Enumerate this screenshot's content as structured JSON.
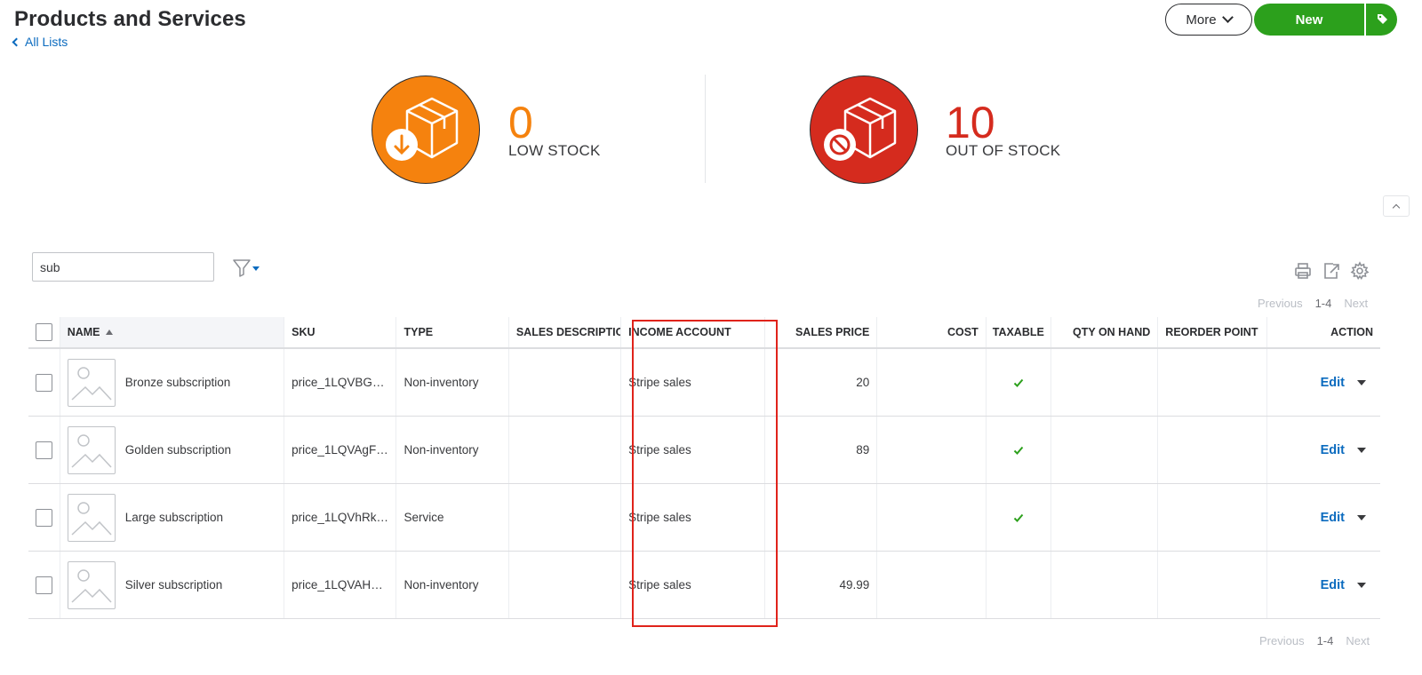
{
  "header": {
    "title": "Products and Services",
    "back_link": "All Lists",
    "more_label": "More",
    "new_label": "New"
  },
  "stats": {
    "low_stock": {
      "count": "0",
      "label": "LOW STOCK",
      "color": "#f5820e"
    },
    "out_of_stock": {
      "count": "10",
      "label": "OUT OF STOCK",
      "color": "#d52b1e"
    }
  },
  "search": {
    "value": "sub"
  },
  "pager": {
    "previous": "Previous",
    "range": "1-4",
    "next": "Next"
  },
  "table": {
    "columns": {
      "name": "NAME",
      "sku": "SKU",
      "type": "TYPE",
      "sales_description": "SALES DESCRIPTION",
      "income_account": "INCOME ACCOUNT",
      "sales_price": "SALES PRICE",
      "cost": "COST",
      "taxable": "TAXABLE",
      "qty_on_hand": "QTY ON HAND",
      "reorder_point": "REORDER POINT",
      "action": "ACTION"
    },
    "rows": [
      {
        "name": "Bronze subscription",
        "sku": "price_1LQVBGF…",
        "type": "Non-inventory",
        "sales_description": "",
        "income_account": "Stripe sales",
        "sales_price": "20",
        "cost": "",
        "taxable": true,
        "qty_on_hand": "",
        "reorder_point": "",
        "action": "Edit"
      },
      {
        "name": "Golden subscription",
        "sku": "price_1LQVAgF…",
        "type": "Non-inventory",
        "sales_description": "",
        "income_account": "Stripe sales",
        "sales_price": "89",
        "cost": "",
        "taxable": true,
        "qty_on_hand": "",
        "reorder_point": "",
        "action": "Edit"
      },
      {
        "name": "Large subscription",
        "sku": "price_1LQVhRk…",
        "type": "Service",
        "sales_description": "",
        "income_account": "Stripe sales",
        "sales_price": "",
        "cost": "",
        "taxable": true,
        "qty_on_hand": "",
        "reorder_point": "",
        "action": "Edit"
      },
      {
        "name": "Silver subscription",
        "sku": "price_1LQVAHF…",
        "type": "Non-inventory",
        "sales_description": "",
        "income_account": "Stripe sales",
        "sales_price": "49.99",
        "cost": "",
        "taxable": false,
        "qty_on_hand": "",
        "reorder_point": "",
        "action": "Edit"
      }
    ]
  },
  "colors": {
    "accent_green": "#2ca01c",
    "link_blue": "#0b6bbf",
    "highlight_red": "#e0231b",
    "check_green": "#2ca01c"
  },
  "icons": [
    "chevron-left-icon",
    "chevron-down-icon",
    "box-download-icon",
    "box-blocked-icon",
    "filter-icon",
    "print-icon",
    "export-icon",
    "gear-icon",
    "image-placeholder-icon",
    "check-icon",
    "caret-down-icon",
    "chevron-up-icon",
    "sort-ascending-icon"
  ]
}
